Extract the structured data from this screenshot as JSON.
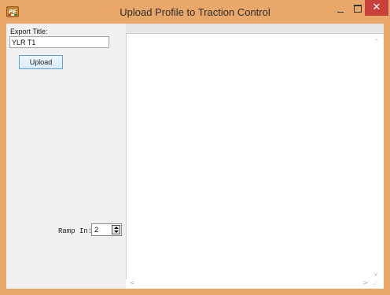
{
  "window": {
    "title": "Upload Profile to Traction Control",
    "icon_name": "app-logo-icon",
    "icon_text": "PE",
    "controls": {
      "minimize_icon": "minimize-icon",
      "maximize_icon": "maximize-icon",
      "close_icon": "close-icon",
      "close_glyph": "✕"
    },
    "colors": {
      "frame": "#e9a86a",
      "close_button": "#c7403a",
      "client": "#f0f0f0",
      "upload_border": "#5c9fd6"
    }
  },
  "export": {
    "label": "Export Title:",
    "value": "YLR T1"
  },
  "upload_button": {
    "label": "Upload"
  },
  "ramp": {
    "label": "Ramp In:",
    "value": "2"
  },
  "scrollbars": {
    "up": "^",
    "down": "v",
    "left": "<",
    "right": ">",
    "grip": ".:"
  }
}
